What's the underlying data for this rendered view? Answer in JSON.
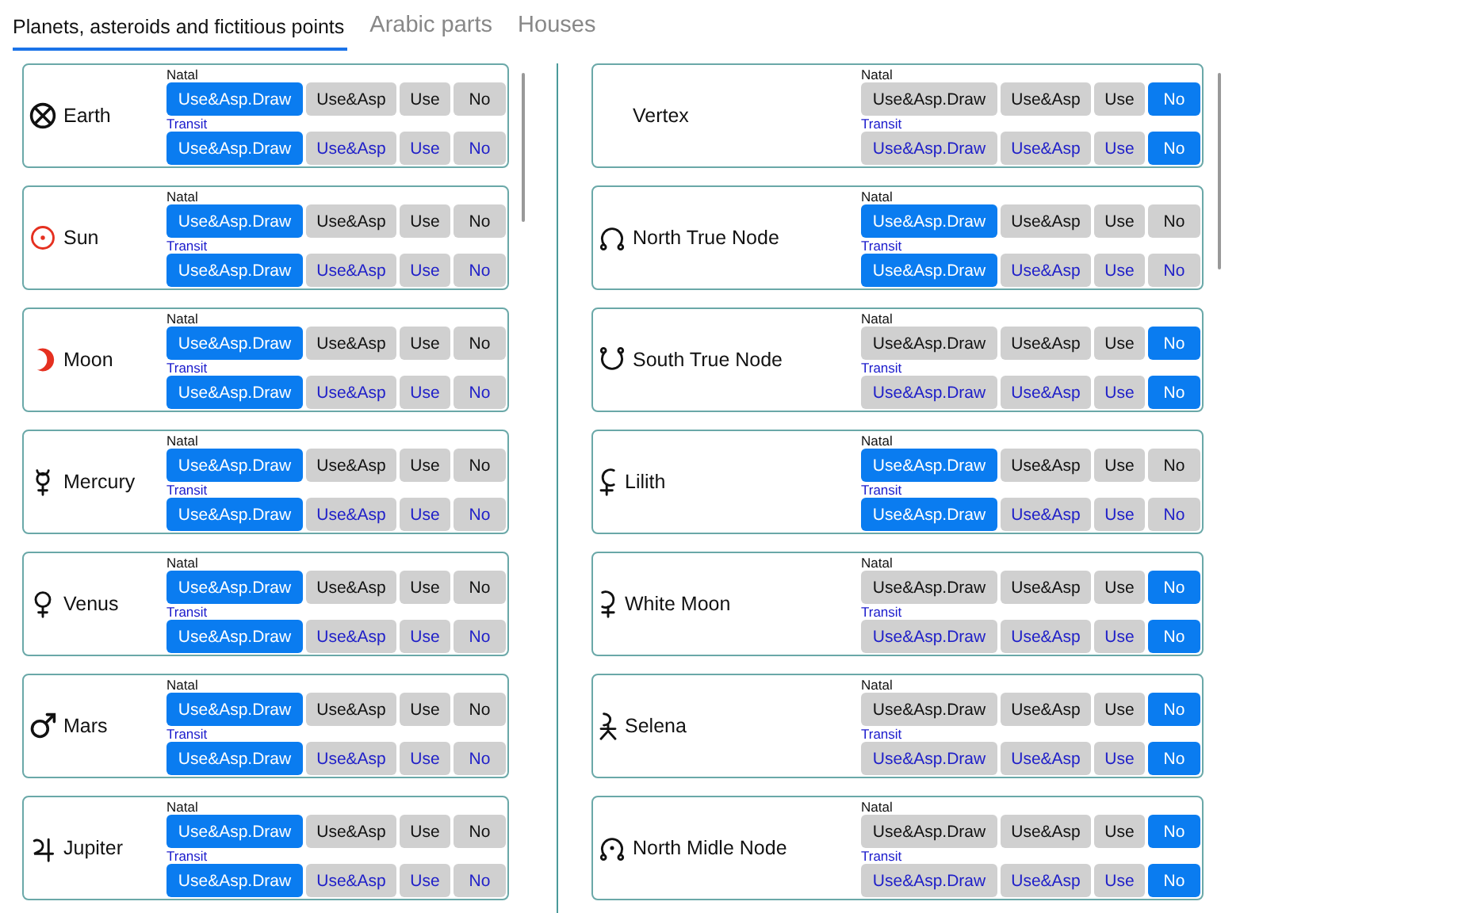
{
  "tabs": [
    {
      "label": "Planets, asteroids and fictitious points",
      "selected": true
    },
    {
      "label": "Arabic parts",
      "selected": false
    },
    {
      "label": "Houses",
      "selected": false
    }
  ],
  "columns": [
    {
      "points": [
        {
          "name": "Earth",
          "kind": "earth",
          "rows": [
            {
              "kind": "natal",
              "label": "Natal",
              "options": [
                {
                  "label": "Use&Asp.Draw",
                  "selected": true
                },
                {
                  "label": "Use&Asp",
                  "selected": false
                },
                {
                  "label": "Use",
                  "selected": false
                },
                {
                  "label": "No",
                  "selected": false
                }
              ]
            },
            {
              "kind": "transit",
              "label": "Transit",
              "options": [
                {
                  "label": "Use&Asp.Draw",
                  "selected": true
                },
                {
                  "label": "Use&Asp",
                  "selected": false
                },
                {
                  "label": "Use",
                  "selected": false
                },
                {
                  "label": "No",
                  "selected": false
                }
              ]
            }
          ]
        },
        {
          "name": "Sun",
          "kind": "sun",
          "rows": [
            {
              "kind": "natal",
              "label": "Natal",
              "options": [
                {
                  "label": "Use&Asp.Draw",
                  "selected": true
                },
                {
                  "label": "Use&Asp",
                  "selected": false
                },
                {
                  "label": "Use",
                  "selected": false
                },
                {
                  "label": "No",
                  "selected": false
                }
              ]
            },
            {
              "kind": "transit",
              "label": "Transit",
              "options": [
                {
                  "label": "Use&Asp.Draw",
                  "selected": true
                },
                {
                  "label": "Use&Asp",
                  "selected": false
                },
                {
                  "label": "Use",
                  "selected": false
                },
                {
                  "label": "No",
                  "selected": false
                }
              ]
            }
          ]
        },
        {
          "name": "Moon",
          "kind": "moon",
          "rows": [
            {
              "kind": "natal",
              "label": "Natal",
              "options": [
                {
                  "label": "Use&Asp.Draw",
                  "selected": true
                },
                {
                  "label": "Use&Asp",
                  "selected": false
                },
                {
                  "label": "Use",
                  "selected": false
                },
                {
                  "label": "No",
                  "selected": false
                }
              ]
            },
            {
              "kind": "transit",
              "label": "Transit",
              "options": [
                {
                  "label": "Use&Asp.Draw",
                  "selected": true
                },
                {
                  "label": "Use&Asp",
                  "selected": false
                },
                {
                  "label": "Use",
                  "selected": false
                },
                {
                  "label": "No",
                  "selected": false
                }
              ]
            }
          ]
        },
        {
          "name": "Mercury",
          "kind": "mercury",
          "rows": [
            {
              "kind": "natal",
              "label": "Natal",
              "options": [
                {
                  "label": "Use&Asp.Draw",
                  "selected": true
                },
                {
                  "label": "Use&Asp",
                  "selected": false
                },
                {
                  "label": "Use",
                  "selected": false
                },
                {
                  "label": "No",
                  "selected": false
                }
              ]
            },
            {
              "kind": "transit",
              "label": "Transit",
              "options": [
                {
                  "label": "Use&Asp.Draw",
                  "selected": true
                },
                {
                  "label": "Use&Asp",
                  "selected": false
                },
                {
                  "label": "Use",
                  "selected": false
                },
                {
                  "label": "No",
                  "selected": false
                }
              ]
            }
          ]
        },
        {
          "name": "Venus",
          "kind": "venus",
          "rows": [
            {
              "kind": "natal",
              "label": "Natal",
              "options": [
                {
                  "label": "Use&Asp.Draw",
                  "selected": true
                },
                {
                  "label": "Use&Asp",
                  "selected": false
                },
                {
                  "label": "Use",
                  "selected": false
                },
                {
                  "label": "No",
                  "selected": false
                }
              ]
            },
            {
              "kind": "transit",
              "label": "Transit",
              "options": [
                {
                  "label": "Use&Asp.Draw",
                  "selected": true
                },
                {
                  "label": "Use&Asp",
                  "selected": false
                },
                {
                  "label": "Use",
                  "selected": false
                },
                {
                  "label": "No",
                  "selected": false
                }
              ]
            }
          ]
        },
        {
          "name": "Mars",
          "kind": "mars",
          "rows": [
            {
              "kind": "natal",
              "label": "Natal",
              "options": [
                {
                  "label": "Use&Asp.Draw",
                  "selected": true
                },
                {
                  "label": "Use&Asp",
                  "selected": false
                },
                {
                  "label": "Use",
                  "selected": false
                },
                {
                  "label": "No",
                  "selected": false
                }
              ]
            },
            {
              "kind": "transit",
              "label": "Transit",
              "options": [
                {
                  "label": "Use&Asp.Draw",
                  "selected": true
                },
                {
                  "label": "Use&Asp",
                  "selected": false
                },
                {
                  "label": "Use",
                  "selected": false
                },
                {
                  "label": "No",
                  "selected": false
                }
              ]
            }
          ]
        },
        {
          "name": "Jupiter",
          "kind": "jupiter",
          "rows": [
            {
              "kind": "natal",
              "label": "Natal",
              "options": [
                {
                  "label": "Use&Asp.Draw",
                  "selected": true
                },
                {
                  "label": "Use&Asp",
                  "selected": false
                },
                {
                  "label": "Use",
                  "selected": false
                },
                {
                  "label": "No",
                  "selected": false
                }
              ]
            },
            {
              "kind": "transit",
              "label": "Transit",
              "options": [
                {
                  "label": "Use&Asp.Draw",
                  "selected": true
                },
                {
                  "label": "Use&Asp",
                  "selected": false
                },
                {
                  "label": "Use",
                  "selected": false
                },
                {
                  "label": "No",
                  "selected": false
                }
              ]
            }
          ]
        }
      ]
    },
    {
      "points": [
        {
          "name": "Vertex",
          "rows": [
            {
              "kind": "natal",
              "label": "Natal",
              "options": [
                {
                  "label": "Use&Asp.Draw",
                  "selected": false
                },
                {
                  "label": "Use&Asp",
                  "selected": false
                },
                {
                  "label": "Use",
                  "selected": false
                },
                {
                  "label": "No",
                  "selected": true
                }
              ]
            },
            {
              "kind": "transit",
              "label": "Transit",
              "options": [
                {
                  "label": "Use&Asp.Draw",
                  "selected": false
                },
                {
                  "label": "Use&Asp",
                  "selected": false
                },
                {
                  "label": "Use",
                  "selected": false
                },
                {
                  "label": "No",
                  "selected": true
                }
              ]
            }
          ]
        },
        {
          "name": "North True Node",
          "kind": "north-node",
          "rows": [
            {
              "kind": "natal",
              "label": "Natal",
              "options": [
                {
                  "label": "Use&Asp.Draw",
                  "selected": true
                },
                {
                  "label": "Use&Asp",
                  "selected": false
                },
                {
                  "label": "Use",
                  "selected": false
                },
                {
                  "label": "No",
                  "selected": false
                }
              ]
            },
            {
              "kind": "transit",
              "label": "Transit",
              "options": [
                {
                  "label": "Use&Asp.Draw",
                  "selected": true
                },
                {
                  "label": "Use&Asp",
                  "selected": false
                },
                {
                  "label": "Use",
                  "selected": false
                },
                {
                  "label": "No",
                  "selected": false
                }
              ]
            }
          ]
        },
        {
          "name": "South True Node",
          "kind": "south-node",
          "rows": [
            {
              "kind": "natal",
              "label": "Natal",
              "options": [
                {
                  "label": "Use&Asp.Draw",
                  "selected": false
                },
                {
                  "label": "Use&Asp",
                  "selected": false
                },
                {
                  "label": "Use",
                  "selected": false
                },
                {
                  "label": "No",
                  "selected": true
                }
              ]
            },
            {
              "kind": "transit",
              "label": "Transit",
              "options": [
                {
                  "label": "Use&Asp.Draw",
                  "selected": false
                },
                {
                  "label": "Use&Asp",
                  "selected": false
                },
                {
                  "label": "Use",
                  "selected": false
                },
                {
                  "label": "No",
                  "selected": true
                }
              ]
            }
          ]
        },
        {
          "name": "Lilith",
          "kind": "lilith",
          "rows": [
            {
              "kind": "natal",
              "label": "Natal",
              "options": [
                {
                  "label": "Use&Asp.Draw",
                  "selected": true
                },
                {
                  "label": "Use&Asp",
                  "selected": false
                },
                {
                  "label": "Use",
                  "selected": false
                },
                {
                  "label": "No",
                  "selected": false
                }
              ]
            },
            {
              "kind": "transit",
              "label": "Transit",
              "options": [
                {
                  "label": "Use&Asp.Draw",
                  "selected": true
                },
                {
                  "label": "Use&Asp",
                  "selected": false
                },
                {
                  "label": "Use",
                  "selected": false
                },
                {
                  "label": "No",
                  "selected": false
                }
              ]
            }
          ]
        },
        {
          "name": "White Moon",
          "kind": "white-moon",
          "rows": [
            {
              "kind": "natal",
              "label": "Natal",
              "options": [
                {
                  "label": "Use&Asp.Draw",
                  "selected": false
                },
                {
                  "label": "Use&Asp",
                  "selected": false
                },
                {
                  "label": "Use",
                  "selected": false
                },
                {
                  "label": "No",
                  "selected": true
                }
              ]
            },
            {
              "kind": "transit",
              "label": "Transit",
              "options": [
                {
                  "label": "Use&Asp.Draw",
                  "selected": false
                },
                {
                  "label": "Use&Asp",
                  "selected": false
                },
                {
                  "label": "Use",
                  "selected": false
                },
                {
                  "label": "No",
                  "selected": true
                }
              ]
            }
          ]
        },
        {
          "name": "Selena",
          "kind": "selena",
          "rows": [
            {
              "kind": "natal",
              "label": "Natal",
              "options": [
                {
                  "label": "Use&Asp.Draw",
                  "selected": false
                },
                {
                  "label": "Use&Asp",
                  "selected": false
                },
                {
                  "label": "Use",
                  "selected": false
                },
                {
                  "label": "No",
                  "selected": true
                }
              ]
            },
            {
              "kind": "transit",
              "label": "Transit",
              "options": [
                {
                  "label": "Use&Asp.Draw",
                  "selected": false
                },
                {
                  "label": "Use&Asp",
                  "selected": false
                },
                {
                  "label": "Use",
                  "selected": false
                },
                {
                  "label": "No",
                  "selected": true
                }
              ]
            }
          ]
        },
        {
          "name": "North Midle Node",
          "kind": "mean-node",
          "rows": [
            {
              "kind": "natal",
              "label": "Natal",
              "options": [
                {
                  "label": "Use&Asp.Draw",
                  "selected": false
                },
                {
                  "label": "Use&Asp",
                  "selected": false
                },
                {
                  "label": "Use",
                  "selected": false
                },
                {
                  "label": "No",
                  "selected": true
                }
              ]
            },
            {
              "kind": "transit",
              "label": "Transit",
              "options": [
                {
                  "label": "Use&Asp.Draw",
                  "selected": false
                },
                {
                  "label": "Use&Asp",
                  "selected": false
                },
                {
                  "label": "Use",
                  "selected": false
                },
                {
                  "label": "No",
                  "selected": true
                }
              ]
            }
          ]
        }
      ]
    }
  ]
}
